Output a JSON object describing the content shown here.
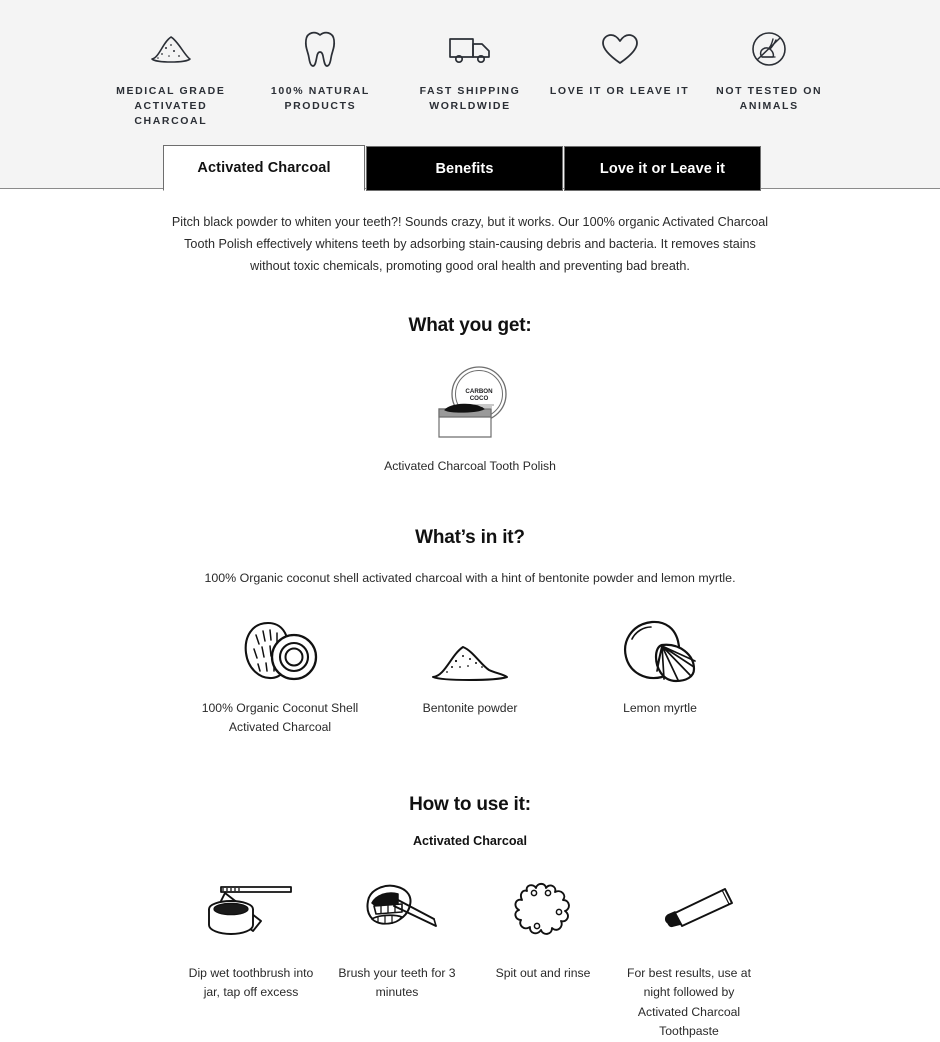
{
  "banner": {
    "badges": [
      {
        "icon": "charcoal-powder-icon",
        "label": "MEDICAL GRADE\nACTIVATED CHARCOAL"
      },
      {
        "icon": "tooth-icon",
        "label": "100% NATURAL\nPRODUCTS"
      },
      {
        "icon": "delivery-truck-icon",
        "label": "FAST SHIPPING\nWORLDWIDE"
      },
      {
        "icon": "heart-icon",
        "label": "LOVE IT OR LEAVE IT"
      },
      {
        "icon": "cruelty-free-rabbit-icon",
        "label": "NOT TESTED ON\nANIMALS"
      }
    ]
  },
  "tabs": [
    {
      "label": "Activated Charcoal",
      "active": true
    },
    {
      "label": "Benefits",
      "active": false
    },
    {
      "label": "Love it or Leave it",
      "active": false
    }
  ],
  "main": {
    "intro": "Pitch black powder to whiten your teeth?! Sounds crazy, but it works. Our 100% organic Activated Charcoal Tooth Polish effectively whitens teeth by adsorbing stain-causing debris and bacteria. It removes stains without toxic chemicals, promoting good oral health and preventing bad breath.",
    "what_you_get": {
      "title": "What you get:",
      "product": {
        "icon": "charcoal-jar-icon",
        "jar_label_line1": "CARBON",
        "jar_label_line2": "COCO",
        "caption": "Activated Charcoal Tooth Polish"
      }
    },
    "whats_in_it": {
      "title": "What’s in it?",
      "subtitle": "100% Organic coconut shell activated charcoal with a hint of bentonite powder and lemon myrtle.",
      "ingredients": [
        {
          "icon": "coconut-icon",
          "caption": "100% Organic Coconut Shell Activated Charcoal"
        },
        {
          "icon": "powder-mound-icon",
          "caption": "Bentonite powder"
        },
        {
          "icon": "lemon-icon",
          "caption": "Lemon myrtle"
        }
      ]
    },
    "how_to_use": {
      "title": "How to use it:",
      "subtitle": "Activated Charcoal",
      "steps": [
        {
          "icon": "jar-and-toothbrush-icon",
          "caption": "Dip wet toothbrush into jar, tap off excess"
        },
        {
          "icon": "brushing-mouth-icon",
          "caption": "Brush your teeth for 3 minutes"
        },
        {
          "icon": "splash-rinse-icon",
          "caption": "Spit out and rinse"
        },
        {
          "icon": "toothpaste-tube-icon",
          "caption": "For best results, use at night followed by Activated Charcoal Toothpaste"
        }
      ]
    }
  },
  "colors": {
    "banner_bg": "#f4f4f4",
    "tab_active_bg": "#ffffff",
    "tab_inactive_bg": "#000000",
    "text": "#1d1d1f",
    "border": "#6e6e6e"
  }
}
